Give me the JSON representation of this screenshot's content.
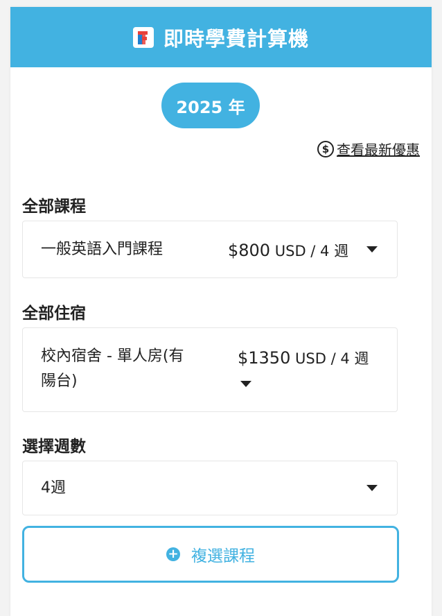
{
  "header": {
    "title": "即時學費計算機",
    "logo_letter": "F"
  },
  "year": {
    "label": "2025 年"
  },
  "promo": {
    "icon": "dollar-circle-icon",
    "label": "查看最新優惠"
  },
  "courses": {
    "label": "全部課程",
    "selected": {
      "name": "一般英語入門課程",
      "price": "$800",
      "unit": " USD / 4 週"
    }
  },
  "accommodation": {
    "label": "全部住宿",
    "selected": {
      "name_line1": "校內宿舍 - 單人房(有",
      "name_line2": "陽台)",
      "price": "$1350",
      "unit": " USD / 4 週"
    }
  },
  "weeks": {
    "label": "選擇週數",
    "selected": "4週"
  },
  "add_course": {
    "icon": "plus-circle-icon",
    "label": "複選課程"
  },
  "colors": {
    "accent": "#42b2e1",
    "text": "#222222",
    "background": "#f3f3f3"
  }
}
